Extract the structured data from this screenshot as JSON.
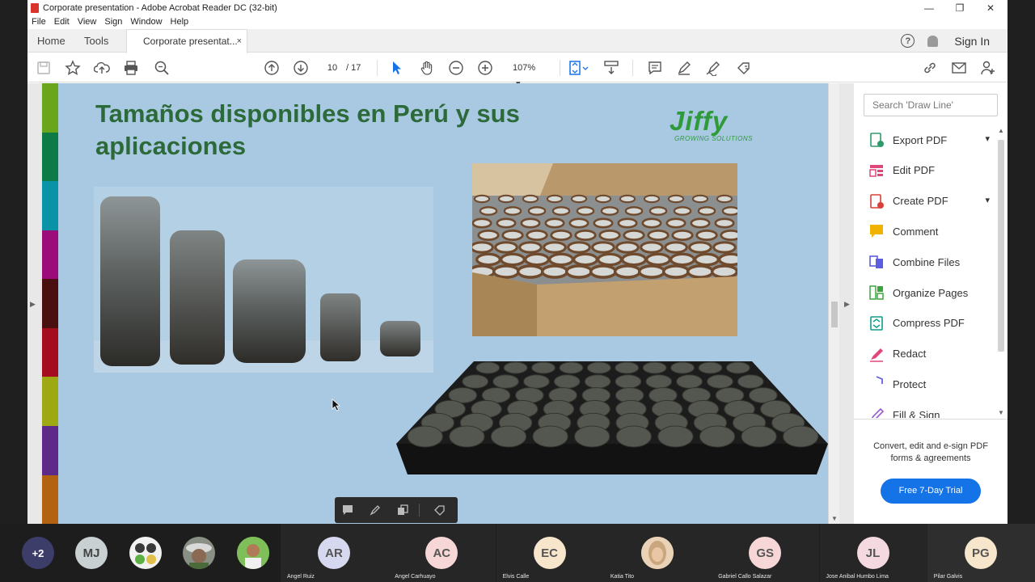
{
  "window": {
    "title": "Corporate presentation - Adobe Acrobat Reader DC (32-bit)",
    "minimize": "—",
    "maximize": "❐",
    "close": "✕"
  },
  "menu": [
    "File",
    "Edit",
    "View",
    "Sign",
    "Window",
    "Help"
  ],
  "tabs": {
    "home": "Home",
    "tools": "Tools",
    "document": "Corporate presentat...",
    "close": "×"
  },
  "header_right": {
    "help": "?",
    "signin": "Sign In"
  },
  "toolbar": {
    "page_current": "10",
    "page_total": "/  17",
    "zoom": "107%",
    "zoom_dropdown": "▾"
  },
  "slide": {
    "title_line1": "Tamaños disponibles en Perú y sus",
    "title_line2": "aplicaciones",
    "logo_word": "Jiffy",
    "logo_sub": "GROWING SOLUTIONS",
    "stripe_colors": [
      "#6aa61d",
      "#0e7a45",
      "#0a93a6",
      "#9c0b7a",
      "#4a1010",
      "#a30d1e",
      "#9ea813",
      "#5e2a8a",
      "#b36211"
    ]
  },
  "right_pane": {
    "search_placeholder": "Search 'Draw Line'",
    "tools": [
      {
        "label": "Export PDF",
        "color": "#2d9c6a",
        "chevron": "▾"
      },
      {
        "label": "Edit PDF",
        "color": "#e0457b"
      },
      {
        "label": "Create PDF",
        "color": "#d8413a",
        "chevron": "▾"
      },
      {
        "label": "Comment",
        "color": "#f0b400"
      },
      {
        "label": "Combine Files",
        "color": "#5c5ce0"
      },
      {
        "label": "Organize Pages",
        "color": "#3aa53a"
      },
      {
        "label": "Compress PDF",
        "color": "#0f9c8c"
      },
      {
        "label": "Redact",
        "color": "#e0457b"
      },
      {
        "label": "Protect",
        "color": "#5c5ce0"
      },
      {
        "label": "Fill & Sign",
        "color": "#9b59d0"
      }
    ],
    "promo_line1": "Convert, edit and e-sign PDF",
    "promo_line2": "forms & agreements",
    "trial_button": "Free 7-Day Trial"
  },
  "meeting": {
    "more": "+2",
    "avatars": [
      {
        "initials": "MJ",
        "bg": "#c8d0d2"
      },
      {
        "initials": "",
        "bg": "#f2f2f2",
        "kind": "emoji-photo"
      },
      {
        "initials": "",
        "bg": "#8a8f86",
        "kind": "hat-photo"
      },
      {
        "initials": "",
        "bg": "#6fae4a",
        "kind": "outdoor-photo"
      }
    ],
    "participants": [
      {
        "name": "Angel Ruiz",
        "initials": "AR",
        "bg": "#d6d8f0"
      },
      {
        "name": "Angel Carhuayo",
        "initials": "AC",
        "bg": "#f6d6d6"
      },
      {
        "name": "Elvis Calle",
        "initials": "EC",
        "bg": "#f8e6cc"
      },
      {
        "name": "Katia Tito",
        "initials": "",
        "bg": "#e9d2b6"
      },
      {
        "name": "Gabriel Callo Salazar",
        "initials": "GS",
        "bg": "#f6d6d6"
      },
      {
        "name": "Jose Anibal Humbo Lima",
        "initials": "JL",
        "bg": "#f4dae0"
      },
      {
        "name": "Pilar Galvis",
        "initials": "PG",
        "bg": "#f8e6cc"
      }
    ]
  }
}
